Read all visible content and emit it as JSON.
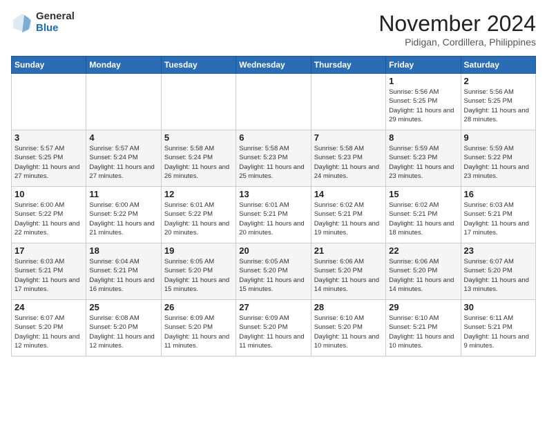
{
  "logo": {
    "general": "General",
    "blue": "Blue"
  },
  "title": "November 2024",
  "location": "Pidigan, Cordillera, Philippines",
  "weekdays": [
    "Sunday",
    "Monday",
    "Tuesday",
    "Wednesday",
    "Thursday",
    "Friday",
    "Saturday"
  ],
  "weeks": [
    [
      {
        "day": "",
        "info": ""
      },
      {
        "day": "",
        "info": ""
      },
      {
        "day": "",
        "info": ""
      },
      {
        "day": "",
        "info": ""
      },
      {
        "day": "",
        "info": ""
      },
      {
        "day": "1",
        "info": "Sunrise: 5:56 AM\nSunset: 5:25 PM\nDaylight: 11 hours and 29 minutes."
      },
      {
        "day": "2",
        "info": "Sunrise: 5:56 AM\nSunset: 5:25 PM\nDaylight: 11 hours and 28 minutes."
      }
    ],
    [
      {
        "day": "3",
        "info": "Sunrise: 5:57 AM\nSunset: 5:25 PM\nDaylight: 11 hours and 27 minutes."
      },
      {
        "day": "4",
        "info": "Sunrise: 5:57 AM\nSunset: 5:24 PM\nDaylight: 11 hours and 27 minutes."
      },
      {
        "day": "5",
        "info": "Sunrise: 5:58 AM\nSunset: 5:24 PM\nDaylight: 11 hours and 26 minutes."
      },
      {
        "day": "6",
        "info": "Sunrise: 5:58 AM\nSunset: 5:23 PM\nDaylight: 11 hours and 25 minutes."
      },
      {
        "day": "7",
        "info": "Sunrise: 5:58 AM\nSunset: 5:23 PM\nDaylight: 11 hours and 24 minutes."
      },
      {
        "day": "8",
        "info": "Sunrise: 5:59 AM\nSunset: 5:23 PM\nDaylight: 11 hours and 23 minutes."
      },
      {
        "day": "9",
        "info": "Sunrise: 5:59 AM\nSunset: 5:22 PM\nDaylight: 11 hours and 23 minutes."
      }
    ],
    [
      {
        "day": "10",
        "info": "Sunrise: 6:00 AM\nSunset: 5:22 PM\nDaylight: 11 hours and 22 minutes."
      },
      {
        "day": "11",
        "info": "Sunrise: 6:00 AM\nSunset: 5:22 PM\nDaylight: 11 hours and 21 minutes."
      },
      {
        "day": "12",
        "info": "Sunrise: 6:01 AM\nSunset: 5:22 PM\nDaylight: 11 hours and 20 minutes."
      },
      {
        "day": "13",
        "info": "Sunrise: 6:01 AM\nSunset: 5:21 PM\nDaylight: 11 hours and 20 minutes."
      },
      {
        "day": "14",
        "info": "Sunrise: 6:02 AM\nSunset: 5:21 PM\nDaylight: 11 hours and 19 minutes."
      },
      {
        "day": "15",
        "info": "Sunrise: 6:02 AM\nSunset: 5:21 PM\nDaylight: 11 hours and 18 minutes."
      },
      {
        "day": "16",
        "info": "Sunrise: 6:03 AM\nSunset: 5:21 PM\nDaylight: 11 hours and 17 minutes."
      }
    ],
    [
      {
        "day": "17",
        "info": "Sunrise: 6:03 AM\nSunset: 5:21 PM\nDaylight: 11 hours and 17 minutes."
      },
      {
        "day": "18",
        "info": "Sunrise: 6:04 AM\nSunset: 5:21 PM\nDaylight: 11 hours and 16 minutes."
      },
      {
        "day": "19",
        "info": "Sunrise: 6:05 AM\nSunset: 5:20 PM\nDaylight: 11 hours and 15 minutes."
      },
      {
        "day": "20",
        "info": "Sunrise: 6:05 AM\nSunset: 5:20 PM\nDaylight: 11 hours and 15 minutes."
      },
      {
        "day": "21",
        "info": "Sunrise: 6:06 AM\nSunset: 5:20 PM\nDaylight: 11 hours and 14 minutes."
      },
      {
        "day": "22",
        "info": "Sunrise: 6:06 AM\nSunset: 5:20 PM\nDaylight: 11 hours and 14 minutes."
      },
      {
        "day": "23",
        "info": "Sunrise: 6:07 AM\nSunset: 5:20 PM\nDaylight: 11 hours and 13 minutes."
      }
    ],
    [
      {
        "day": "24",
        "info": "Sunrise: 6:07 AM\nSunset: 5:20 PM\nDaylight: 11 hours and 12 minutes."
      },
      {
        "day": "25",
        "info": "Sunrise: 6:08 AM\nSunset: 5:20 PM\nDaylight: 11 hours and 12 minutes."
      },
      {
        "day": "26",
        "info": "Sunrise: 6:09 AM\nSunset: 5:20 PM\nDaylight: 11 hours and 11 minutes."
      },
      {
        "day": "27",
        "info": "Sunrise: 6:09 AM\nSunset: 5:20 PM\nDaylight: 11 hours and 11 minutes."
      },
      {
        "day": "28",
        "info": "Sunrise: 6:10 AM\nSunset: 5:20 PM\nDaylight: 11 hours and 10 minutes."
      },
      {
        "day": "29",
        "info": "Sunrise: 6:10 AM\nSunset: 5:21 PM\nDaylight: 11 hours and 10 minutes."
      },
      {
        "day": "30",
        "info": "Sunrise: 6:11 AM\nSunset: 5:21 PM\nDaylight: 11 hours and 9 minutes."
      }
    ]
  ]
}
